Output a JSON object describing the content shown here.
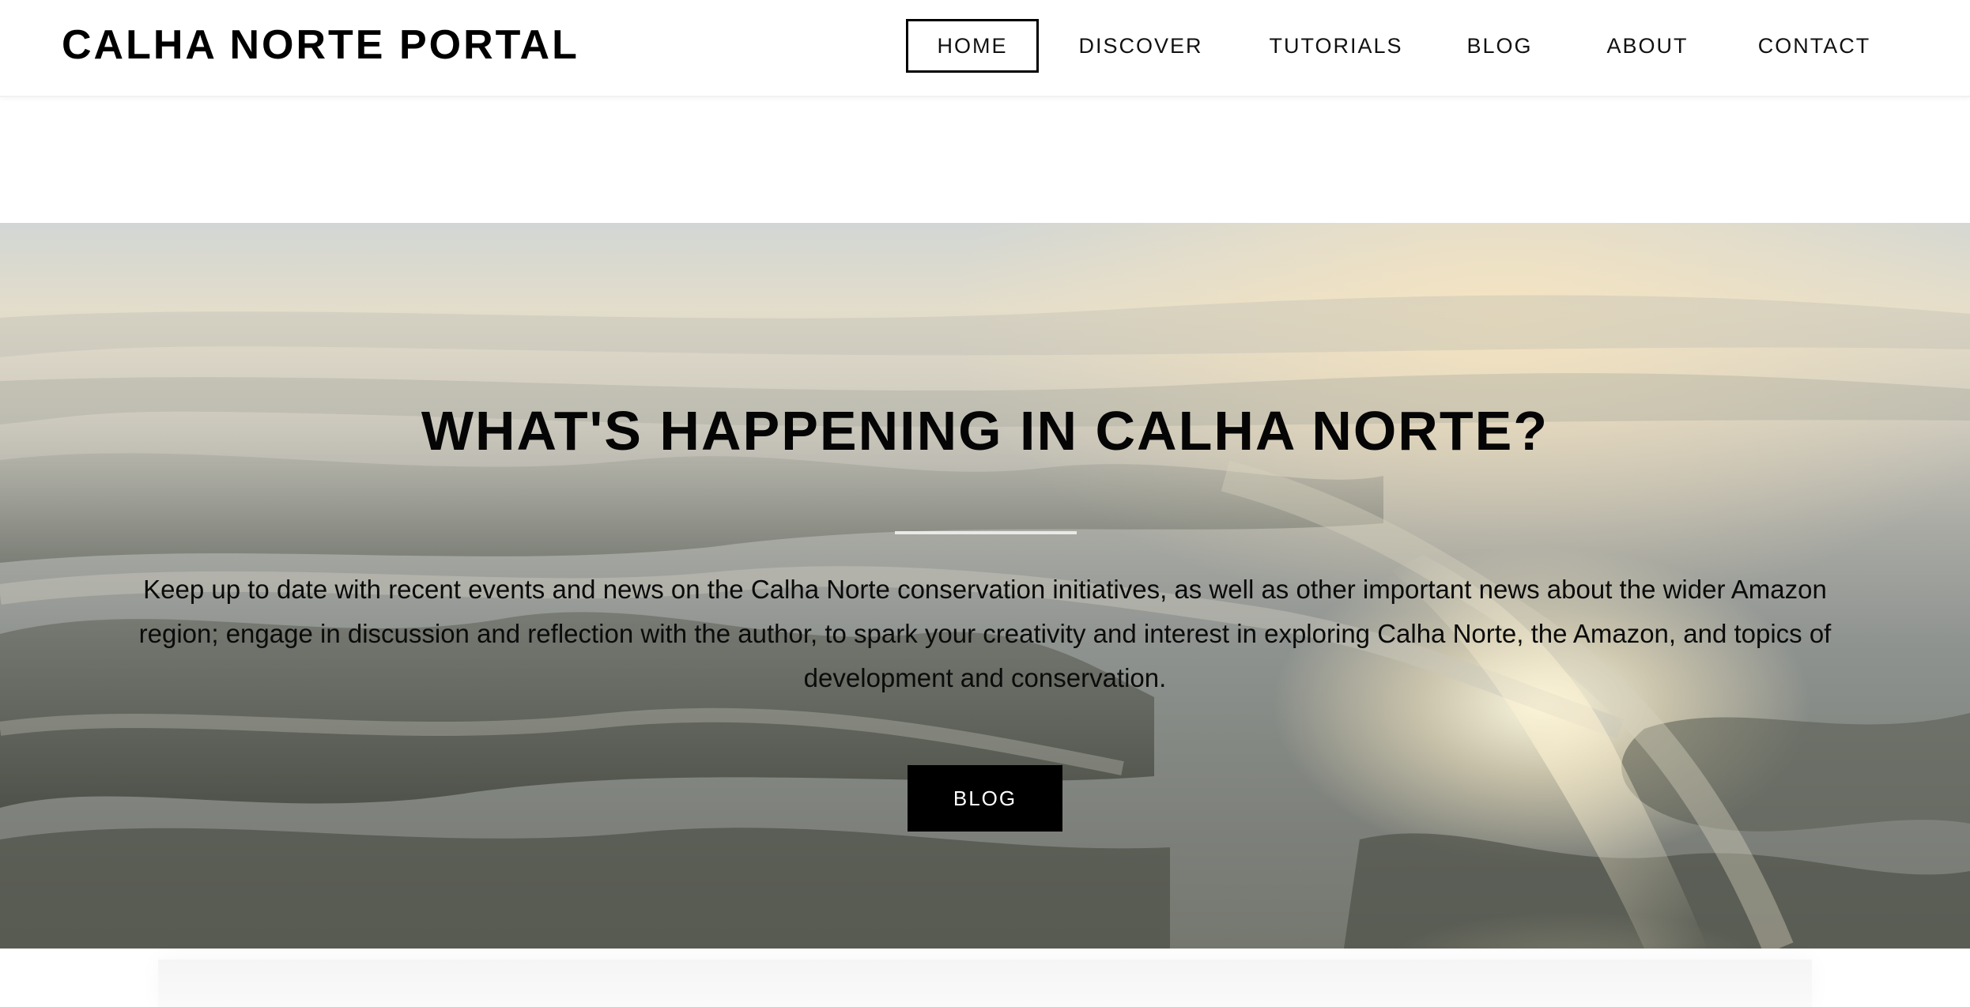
{
  "header": {
    "site_title": "CALHA NORTE PORTAL",
    "nav": [
      {
        "label": "HOME",
        "active": true
      },
      {
        "label": "DISCOVER",
        "active": false
      },
      {
        "label": "TUTORIALS",
        "active": false
      },
      {
        "label": "BLOG",
        "active": false
      },
      {
        "label": "ABOUT",
        "active": false
      },
      {
        "label": "CONTACT",
        "active": false
      }
    ]
  },
  "hero": {
    "title": "WHAT'S HAPPENING IN CALHA NORTE?",
    "description": "Keep up to date with recent events and news on the Calha Norte conservation initiatives, as well as other important news about the wider Amazon region; engage in discussion and reflection with the author, to spark your creativity and interest in exploring Calha Norte, the Amazon, and topics of development and conservation.",
    "button_label": "BLOG",
    "background_image": "aerial-river-landscape"
  },
  "colors": {
    "text": "#000000",
    "button_bg": "#000000",
    "button_text": "#ffffff",
    "header_bg": "#ffffff"
  }
}
